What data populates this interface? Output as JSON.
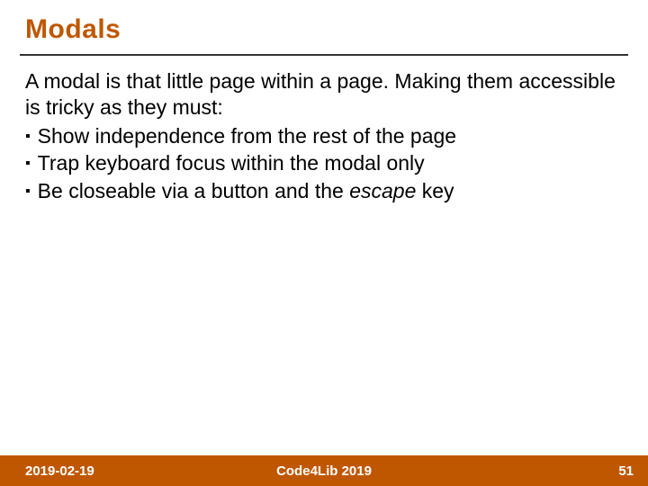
{
  "title": "Modals",
  "intro": "A modal is that little page within a page. Making them accessible is tricky as they must:",
  "bullets": {
    "b1": "Show independence from the rest of the page",
    "b2": "Trap keyboard focus within the modal only",
    "b3_prefix": "Be closeable via a button and the ",
    "b3_italic": "escape",
    "b3_suffix": " key"
  },
  "footer": {
    "date": "2019-02-19",
    "venue": "Code4Lib 2019",
    "page": "51"
  }
}
